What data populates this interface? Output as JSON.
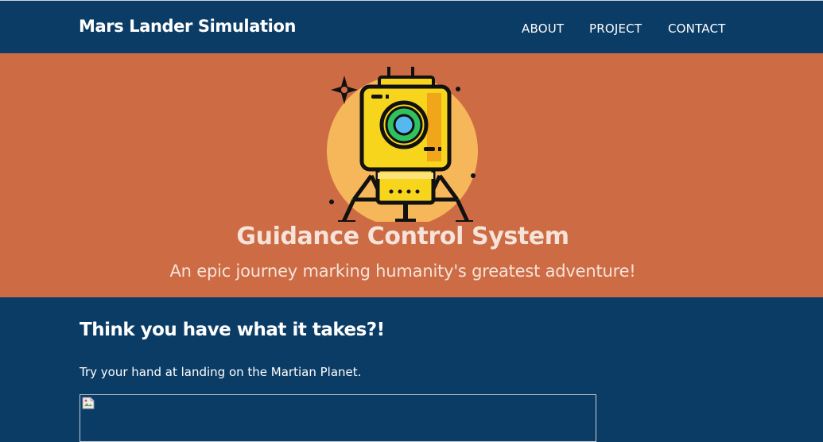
{
  "navbar": {
    "brand": "Mars Lander Simulation",
    "links": [
      "ABOUT",
      "PROJECT",
      "CONTACT"
    ]
  },
  "hero": {
    "icon": "lunar-lander-icon",
    "title": "Guidance Control System",
    "subtitle": "An epic journey marking humanity's greatest adventure!"
  },
  "main": {
    "heading": "Think you have what it takes?!",
    "text": "Try your hand at landing on the Martian Planet.",
    "simulation_icon": "broken-image-icon"
  },
  "colors": {
    "navy": "#0b3c66",
    "mars_orange": "#cd6c44",
    "lander_yellow": "#f7d51d",
    "halo": "#f6b65a",
    "lens_green": "#2fc25f",
    "lens_blue": "#55b9ef"
  }
}
